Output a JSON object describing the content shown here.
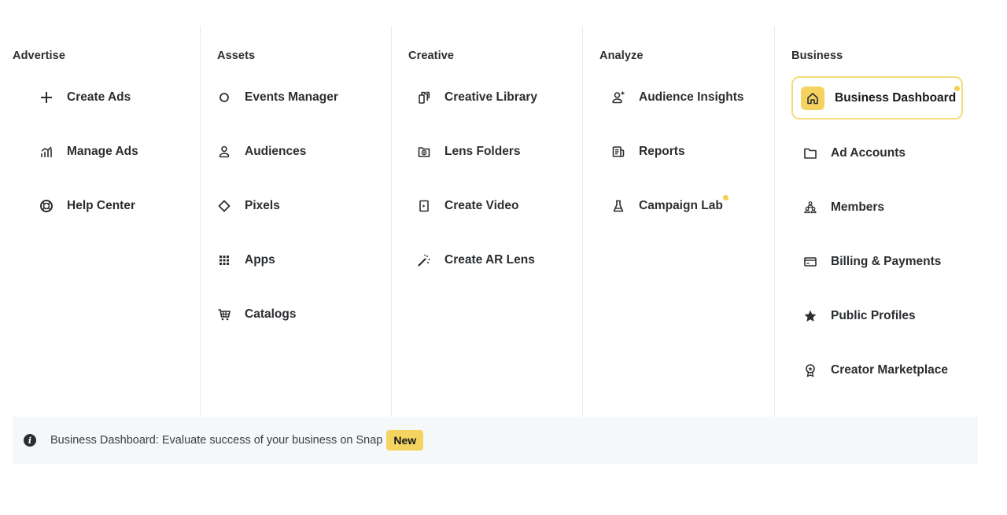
{
  "columns": [
    {
      "title": "Advertise",
      "items": [
        {
          "label": "Create Ads",
          "icon": "plus-icon"
        },
        {
          "label": "Manage Ads",
          "icon": "bar-chart-icon"
        },
        {
          "label": "Help Center",
          "icon": "lifebuoy-icon"
        }
      ]
    },
    {
      "title": "Assets",
      "items": [
        {
          "label": "Events Manager",
          "icon": "circle-icon"
        },
        {
          "label": "Audiences",
          "icon": "person-icon"
        },
        {
          "label": "Pixels",
          "icon": "diamond-icon"
        },
        {
          "label": "Apps",
          "icon": "grid-icon"
        },
        {
          "label": "Catalogs",
          "icon": "cart-icon"
        }
      ]
    },
    {
      "title": "Creative",
      "items": [
        {
          "label": "Creative Library",
          "icon": "stacked-cards-icon"
        },
        {
          "label": "Lens Folders",
          "icon": "lens-folder-icon"
        },
        {
          "label": "Create Video",
          "icon": "video-icon"
        },
        {
          "label": "Create AR Lens",
          "icon": "magic-wand-icon"
        }
      ]
    },
    {
      "title": "Analyze",
      "items": [
        {
          "label": "Audience Insights",
          "icon": "person-plus-icon"
        },
        {
          "label": "Reports",
          "icon": "report-icon"
        },
        {
          "label": "Campaign Lab",
          "icon": "flask-icon",
          "new_dot": true
        }
      ]
    },
    {
      "title": "Business",
      "active_item": {
        "label": "Business Dashboard",
        "icon": "home-icon",
        "new_dot": true
      },
      "items": [
        {
          "label": "Ad Accounts",
          "icon": "folder-icon"
        },
        {
          "label": "Members",
          "icon": "members-icon"
        },
        {
          "label": "Billing & Payments",
          "icon": "credit-card-icon"
        },
        {
          "label": "Public Profiles",
          "icon": "star-icon"
        },
        {
          "label": "Creator Marketplace",
          "icon": "badge-icon"
        }
      ]
    }
  ],
  "footer": {
    "icon": "info-icon",
    "message": "Business Dashboard: Evaluate success of your business on Snap",
    "badge": "New"
  },
  "colors": {
    "accent_yellow": "#f4d35e",
    "active_border": "#f3dc7c",
    "footer_bg": "#f6f7f9",
    "text": "#2b2e31"
  }
}
